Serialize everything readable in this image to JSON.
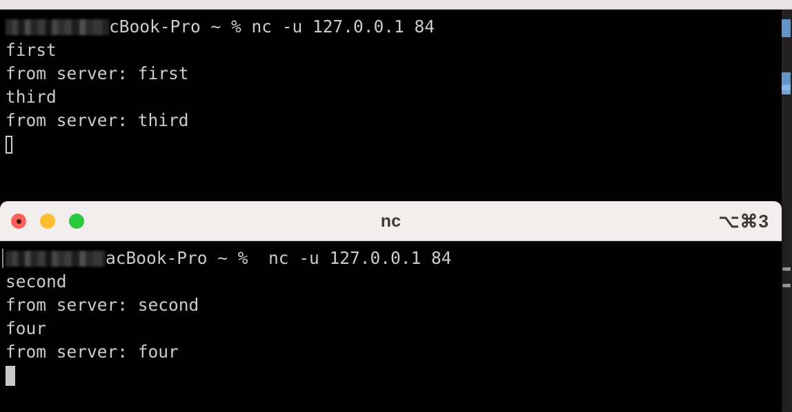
{
  "desktop": {
    "background_color": "#000000"
  },
  "background_window_right": {
    "name": "partial-window-edge",
    "color": "#232323",
    "accent_color": "#6fa8e8"
  },
  "top_strip": {
    "name": "partial-titlebar-above",
    "color": "#e9e4e3"
  },
  "back_terminal": {
    "title": "",
    "focused": false,
    "background_color": "#000000",
    "text_color": "#cccccc",
    "lines": [
      {
        "type": "prompt",
        "hostname_redacted": true,
        "suffix": "cBook-Pro ~ % nc -u 127.0.0.1 84"
      },
      {
        "type": "output",
        "text": "first"
      },
      {
        "type": "output",
        "text": "from server: first"
      },
      {
        "type": "output",
        "text": "third"
      },
      {
        "type": "output",
        "text": "from server: third"
      }
    ],
    "cursor": "hollow-box"
  },
  "front_terminal": {
    "title": "nc",
    "shortcut": "⌥⌘3",
    "focused": true,
    "background_color": "#000000",
    "titlebar_color": "#f2eeed",
    "text_color": "#cccccc",
    "traffic_lights": [
      {
        "name": "close",
        "label": "Close",
        "color": "#fc6058"
      },
      {
        "name": "minimize",
        "label": "Minimize",
        "color": "#fdbc2e"
      },
      {
        "name": "zoom",
        "label": "Zoom",
        "color": "#29c83f"
      }
    ],
    "lines": [
      {
        "type": "prompt",
        "hostname_redacted": true,
        "suffix": "acBook-Pro ~ %  nc -u 127.0.0.1 84"
      },
      {
        "type": "output",
        "text": "second"
      },
      {
        "type": "output",
        "text": "from server: second"
      },
      {
        "type": "output",
        "text": "four"
      },
      {
        "type": "output",
        "text": "from server: four"
      }
    ],
    "cursor": "filled-block"
  }
}
